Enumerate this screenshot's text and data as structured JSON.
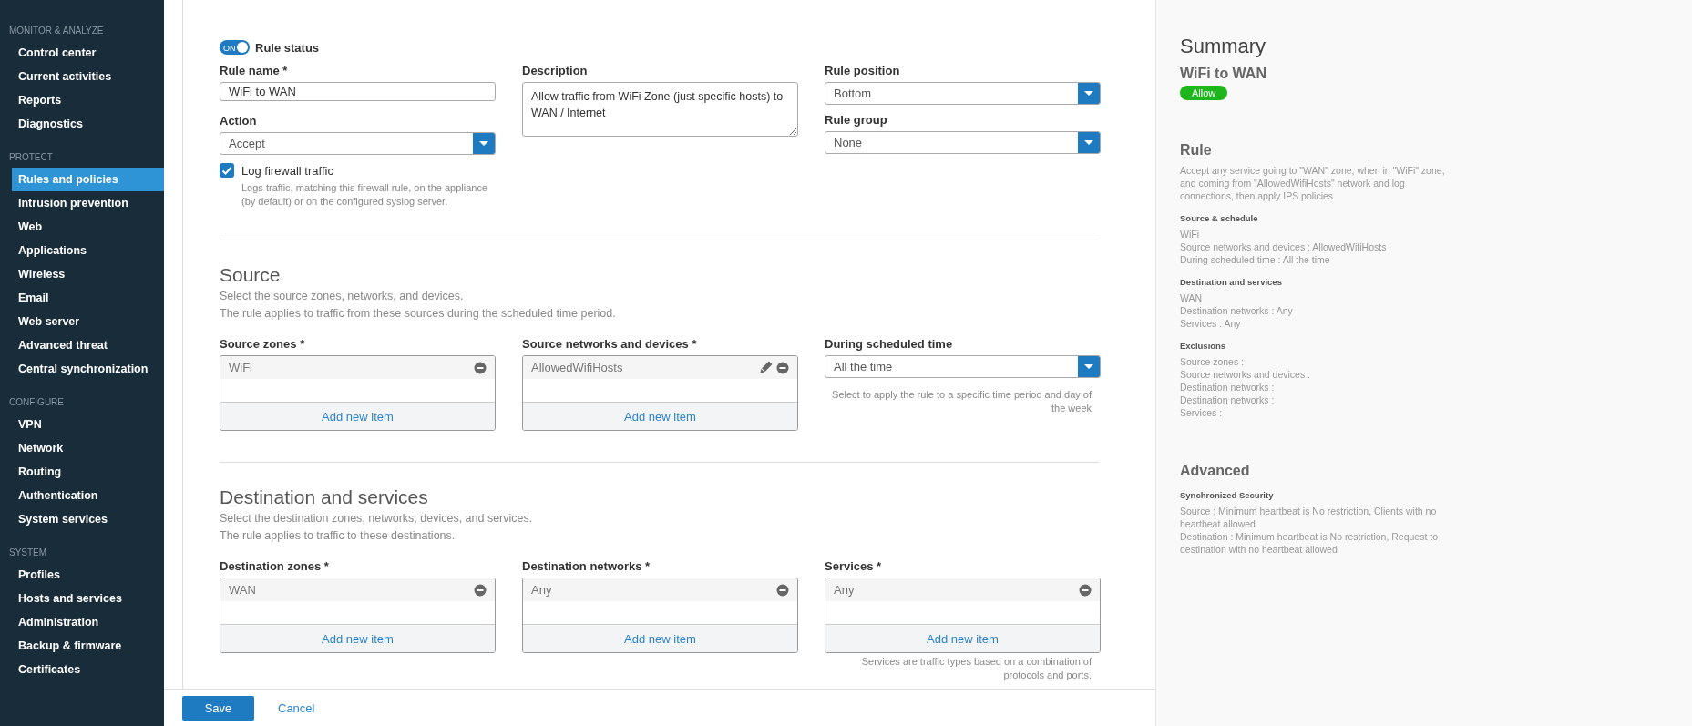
{
  "sidebar": {
    "sections": [
      {
        "title": "MONITOR & ANALYZE",
        "items": [
          {
            "label": "Control center",
            "selected": false
          },
          {
            "label": "Current activities",
            "selected": false
          },
          {
            "label": "Reports",
            "selected": false
          },
          {
            "label": "Diagnostics",
            "selected": false
          }
        ]
      },
      {
        "title": "PROTECT",
        "items": [
          {
            "label": "Rules and policies",
            "selected": true
          },
          {
            "label": "Intrusion prevention",
            "selected": false
          },
          {
            "label": "Web",
            "selected": false
          },
          {
            "label": "Applications",
            "selected": false
          },
          {
            "label": "Wireless",
            "selected": false
          },
          {
            "label": "Email",
            "selected": false
          },
          {
            "label": "Web server",
            "selected": false
          },
          {
            "label": "Advanced threat",
            "selected": false
          },
          {
            "label": "Central synchronization",
            "selected": false
          }
        ]
      },
      {
        "title": "CONFIGURE",
        "items": [
          {
            "label": "VPN",
            "selected": false
          },
          {
            "label": "Network",
            "selected": false
          },
          {
            "label": "Routing",
            "selected": false
          },
          {
            "label": "Authentication",
            "selected": false
          },
          {
            "label": "System services",
            "selected": false
          }
        ]
      },
      {
        "title": "SYSTEM",
        "items": [
          {
            "label": "Profiles",
            "selected": false
          },
          {
            "label": "Hosts and services",
            "selected": false
          },
          {
            "label": "Administration",
            "selected": false
          },
          {
            "label": "Backup & firmware",
            "selected": false
          },
          {
            "label": "Certificates",
            "selected": false
          }
        ]
      }
    ]
  },
  "rule_status": {
    "label": "Rule status",
    "toggle_text": "ON",
    "on": true
  },
  "rule_name": {
    "label": "Rule name *",
    "value": "WiFi to WAN"
  },
  "action": {
    "label": "Action",
    "value": "Accept"
  },
  "log_traffic": {
    "label": "Log firewall traffic",
    "checked": true,
    "hint": "Logs traffic, matching this firewall rule, on the appliance (by default) or on the configured syslog server."
  },
  "description": {
    "label": "Description",
    "value": "Allow traffic from WiFi Zone (just specific hosts) to WAN / Internet"
  },
  "rule_position": {
    "label": "Rule position",
    "value": "Bottom"
  },
  "rule_group": {
    "label": "Rule group",
    "value": "None"
  },
  "sections": [
    {
      "title": "Source",
      "lines": [
        "Select the source zones, networks, and devices.",
        "The rule applies to traffic from these sources during the scheduled time period."
      ],
      "fields": [
        {
          "kind": "list",
          "label": "Source zones *",
          "items": [
            {
              "text": "WiFi",
              "editable": false
            }
          ],
          "add_label": "Add new item"
        },
        {
          "kind": "list",
          "label": "Source networks and devices *",
          "items": [
            {
              "text": "AllowedWifiHosts",
              "editable": true
            }
          ],
          "add_label": "Add new item"
        },
        {
          "kind": "select",
          "label": "During scheduled time",
          "value": "All the time",
          "hint": "Select to apply the rule to a specific time period and day of the week"
        }
      ]
    },
    {
      "title": "Destination and services",
      "lines": [
        "Select the destination zones, networks, devices, and services.",
        "The rule applies to traffic to these destinations."
      ],
      "fields": [
        {
          "kind": "list",
          "label": "Destination zones *",
          "items": [
            {
              "text": "WAN",
              "editable": false
            }
          ],
          "add_label": "Add new item"
        },
        {
          "kind": "list",
          "label": "Destination networks *",
          "items": [
            {
              "text": "Any",
              "editable": false
            }
          ],
          "add_label": "Add new item"
        },
        {
          "kind": "list",
          "label": "Services *",
          "items": [
            {
              "text": "Any",
              "editable": false
            }
          ],
          "add_label": "Add new item",
          "hint": "Services are traffic types based on a combination of protocols and ports."
        }
      ]
    }
  ],
  "footer": {
    "save": "Save",
    "cancel": "Cancel"
  },
  "summary": {
    "title": "Summary",
    "rule_name": "WiFi to WAN",
    "badge": "Allow",
    "sections": [
      {
        "heading": "Rule",
        "text": "Accept any service going to \"WAN\" zone, when in \"WiFi\" zone, and coming from \"AllowedWifiHosts\" network and log connections, then apply IPS policies",
        "groups": [
          {
            "title": "Source & schedule",
            "lines": [
              "WiFi",
              "Source networks and devices : AllowedWifiHosts",
              "During scheduled time : All the time"
            ]
          },
          {
            "title": "Destination and services",
            "lines": [
              "WAN",
              "Destination networks : Any",
              "Services : Any"
            ]
          },
          {
            "title": "Exclusions",
            "lines": [
              "Source zones :",
              "Source networks and devices :",
              "Destination networks :",
              "Destination networks :",
              "Services :"
            ]
          }
        ]
      },
      {
        "heading": "Advanced",
        "groups": [
          {
            "title": "Synchronized Security",
            "lines": [
              "Source : Minimum heartbeat is No restriction, Clients with no heartbeat allowed",
              "Destination : Minimum heartbeat is No restriction, Request to destination with no heartbeat allowed"
            ]
          }
        ]
      }
    ]
  }
}
